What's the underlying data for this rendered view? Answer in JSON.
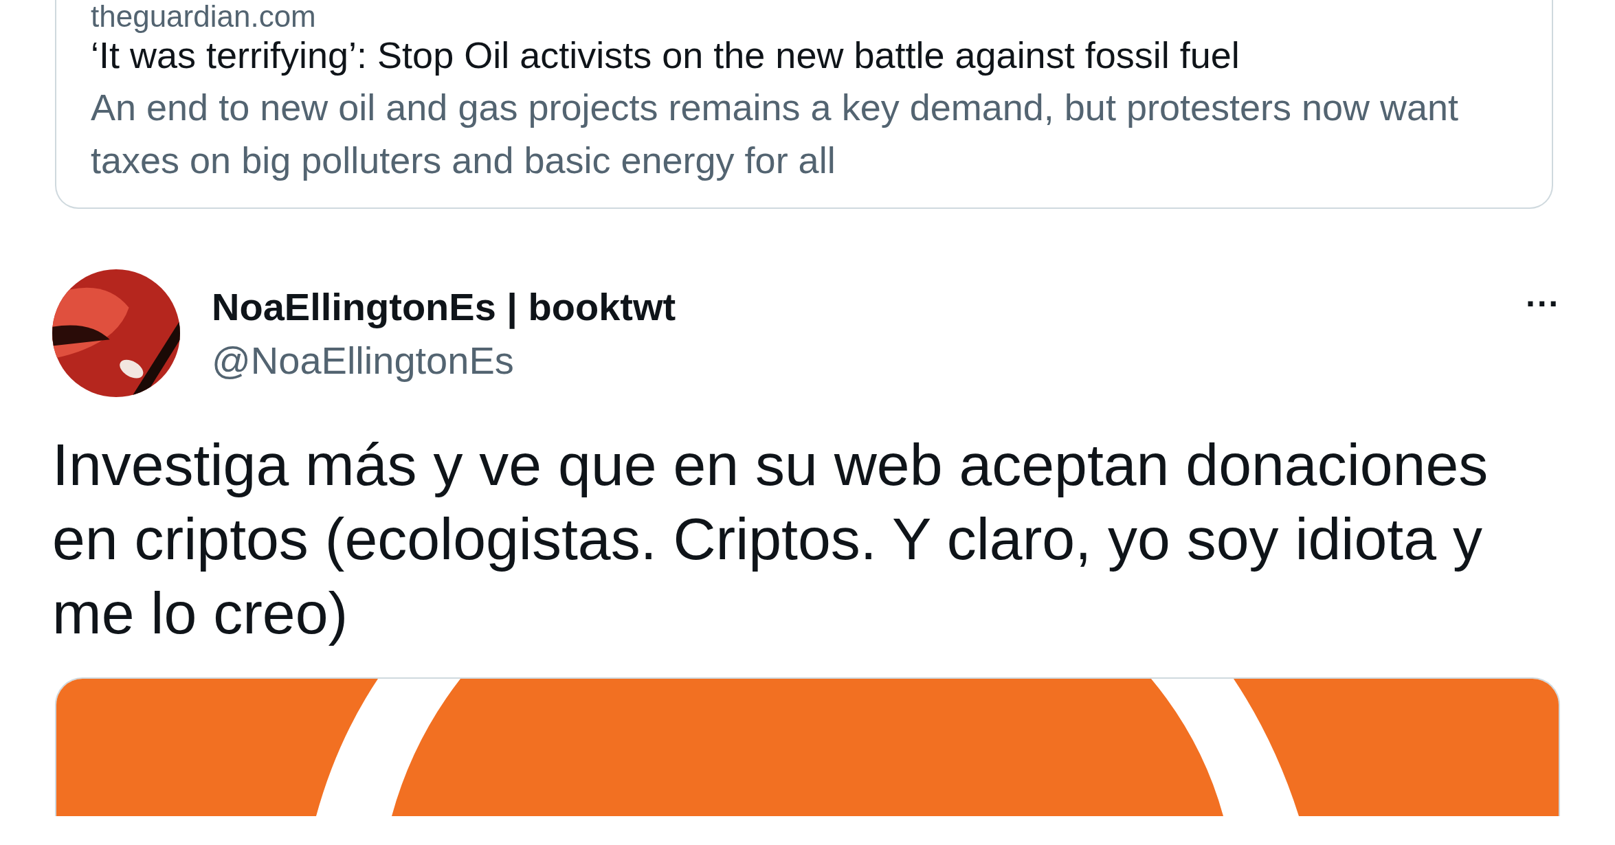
{
  "link_card": {
    "domain": "theguardian.com",
    "title": "‘It was terrifying’: Stop Oil activists on the new battle against fossil fuel",
    "description": "An end to new oil and gas projects remains a key demand, but protesters now want taxes on big polluters and basic energy for all"
  },
  "tweet": {
    "display_name": "NoaEllingtonEs | booktwt",
    "handle": "@NoaEllingtonEs",
    "more": "···",
    "text": "Investiga más y ve que en su web aceptan donaciones en criptos (ecologistas. Criptos. Y claro, yo soy idiota y me lo creo)"
  }
}
